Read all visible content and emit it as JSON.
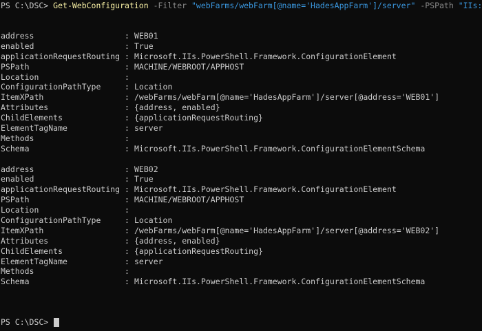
{
  "command": {
    "prompt": "PS C:\\DSC> ",
    "cmdlet": "Get-WebConfiguration",
    "filter_param": " -Filter ",
    "filter_value": "\"webFarms/webFarm[@name='HadesAppFarm']/server\"",
    "pspath_param": " -PSPath ",
    "pspath_value": "\"IIs:"
  },
  "records": [
    {
      "rows": [
        {
          "key": "address",
          "sep": ":",
          "value": "WEB01"
        },
        {
          "key": "enabled",
          "sep": ":",
          "value": "True"
        },
        {
          "key": "applicationRequestRouting",
          "sep": ":",
          "value": "Microsoft.IIs.PowerShell.Framework.ConfigurationElement"
        },
        {
          "key": "PSPath",
          "sep": ":",
          "value": "MACHINE/WEBROOT/APPHOST"
        },
        {
          "key": "Location",
          "sep": ":",
          "value": ""
        },
        {
          "key": "ConfigurationPathType",
          "sep": ":",
          "value": "Location"
        },
        {
          "key": "ItemXPath",
          "sep": ":",
          "value": "/webFarms/webFarm[@name='HadesAppFarm']/server[@address='WEB01']"
        },
        {
          "key": "Attributes",
          "sep": ":",
          "value": "{address, enabled}"
        },
        {
          "key": "ChildElements",
          "sep": ":",
          "value": "{applicationRequestRouting}"
        },
        {
          "key": "ElementTagName",
          "sep": ":",
          "value": "server"
        },
        {
          "key": "Methods",
          "sep": ":",
          "value": ""
        },
        {
          "key": "Schema",
          "sep": ":",
          "value": "Microsoft.IIs.PowerShell.Framework.ConfigurationElementSchema"
        }
      ]
    },
    {
      "rows": [
        {
          "key": "address",
          "sep": ":",
          "value": "WEB02"
        },
        {
          "key": "enabled",
          "sep": ":",
          "value": "True"
        },
        {
          "key": "applicationRequestRouting",
          "sep": ":",
          "value": "Microsoft.IIs.PowerShell.Framework.ConfigurationElement"
        },
        {
          "key": "PSPath",
          "sep": ":",
          "value": "MACHINE/WEBROOT/APPHOST"
        },
        {
          "key": "Location",
          "sep": ":",
          "value": ""
        },
        {
          "key": "ConfigurationPathType",
          "sep": ":",
          "value": "Location"
        },
        {
          "key": "ItemXPath",
          "sep": ":",
          "value": "/webFarms/webFarm[@name='HadesAppFarm']/server[@address='WEB02']"
        },
        {
          "key": "Attributes",
          "sep": ":",
          "value": "{address, enabled}"
        },
        {
          "key": "ChildElements",
          "sep": ":",
          "value": "{applicationRequestRouting}"
        },
        {
          "key": "ElementTagName",
          "sep": ":",
          "value": "server"
        },
        {
          "key": "Methods",
          "sep": ":",
          "value": ""
        },
        {
          "key": "Schema",
          "sep": ":",
          "value": "Microsoft.IIs.PowerShell.Framework.ConfigurationElementSchema"
        }
      ]
    }
  ],
  "final_prompt": "PS C:\\DSC> ",
  "colors": {
    "background": "#0c0c0c",
    "foreground": "#cccccc",
    "cmdlet": "#f9f1a5",
    "parameter": "#8a8a8a",
    "string": "#3a96dd"
  }
}
